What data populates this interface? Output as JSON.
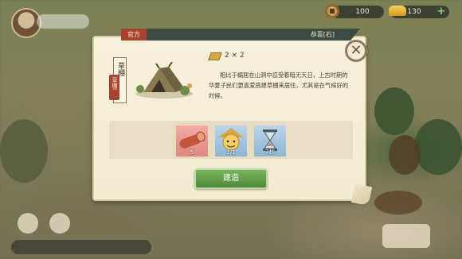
{
  "hud": {
    "copper_amount": "100",
    "gold_amount": "130",
    "add_symbol": "+"
  },
  "dialog": {
    "source_tag": "官方",
    "credit": "恭喜[石]",
    "building_name": "草棚",
    "category_badge": "草棚I",
    "size": "2 × 2",
    "description": "相比于蜗居在山洞中忍受着暗无天日，上古时期的华夏子民们更喜爱搭建草棚来居住，尤其是在气候好的时候。",
    "close_symbol": "✕",
    "materials": [
      {
        "icon": "wood-log-icon",
        "qty": "5"
      },
      {
        "icon": "worker-icon",
        "qty": "1/1"
      },
      {
        "icon": "hourglass-icon",
        "qty": "2秒"
      }
    ],
    "build_label": "建造"
  },
  "colors": {
    "title_bar": "#3d4a44",
    "tag_red": "#a8432f",
    "build_green": "#5f9a47",
    "parchment": "#f5eed8"
  }
}
